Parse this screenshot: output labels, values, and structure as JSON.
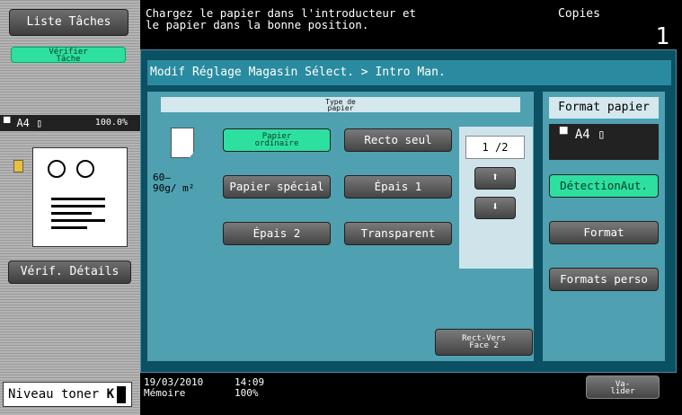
{
  "left": {
    "list_tasks": "Liste Tâches",
    "verify_task": "Vérifier\nTâche",
    "thumb_size": "A4",
    "thumb_zoom": "100.0%",
    "details": "Vérif. Détails",
    "toner_label": "Niveau toner"
  },
  "header": {
    "message": "Chargez le papier dans l'introducteur et\nle papier dans la bonne position.",
    "copies_label": "Copies",
    "copies_value": "1"
  },
  "main": {
    "breadcrumb": "Modif Réglage Magasin Sélect. > Intro Man.",
    "type_header": "Type de\npapier",
    "weight": "60–\n90g/ m²",
    "buttons": {
      "plain": "Papier\nordinaire",
      "single": "Recto seul",
      "special": "Papier spécial",
      "thick1": "Épais 1",
      "thick2": "Épais 2",
      "transparent": "Transparent"
    },
    "page_count": "1 /2",
    "rect_verso": "Rect-Vers\nFace 2"
  },
  "format": {
    "title": "Format papier",
    "current": "A4",
    "auto": "DétectionAut.",
    "format": "Format",
    "custom": "Formats perso"
  },
  "status": {
    "date": "19/03/2010",
    "time": "14:09",
    "memory_label": "Mémoire",
    "memory_value": "100%"
  },
  "validate": "Va-\nlider"
}
